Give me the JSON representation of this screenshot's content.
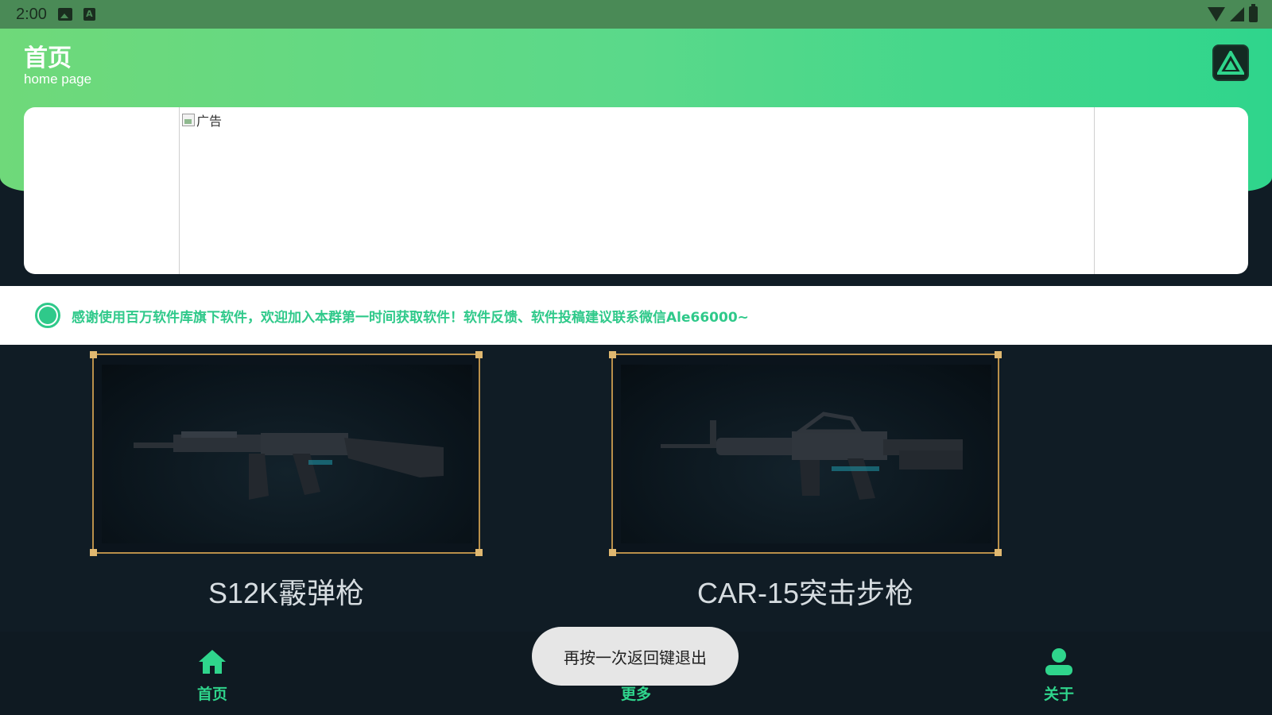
{
  "status_bar": {
    "time": "2:00",
    "icons": [
      "image-icon",
      "a-badge-icon",
      "wifi-icon",
      "signal-icon",
      "battery-icon"
    ],
    "a_badge": "A"
  },
  "header": {
    "title": "首页",
    "subtitle": "home page",
    "logo_icon": "app-logo-triangle-icon"
  },
  "ad": {
    "alt_text": "广告"
  },
  "notice": {
    "text": "感谢使用百万软件库旗下软件，欢迎加入本群第一时间获取软件！软件反馈、软件投稿建议联系微信Ale66000~"
  },
  "weapons": [
    {
      "name": "S12K霰弹枪"
    },
    {
      "name": "CAR-15突击步枪"
    }
  ],
  "nav": {
    "items": [
      {
        "label": "首页",
        "icon": "home-icon"
      },
      {
        "label": "更多",
        "icon": "grid-icon"
      },
      {
        "label": "关于",
        "icon": "user-icon"
      }
    ]
  },
  "toast": {
    "text": "再按一次返回键退出"
  },
  "colors": {
    "accent": "#2fd58c",
    "frame_gold": "#b98f4a",
    "background": "#101c25"
  }
}
